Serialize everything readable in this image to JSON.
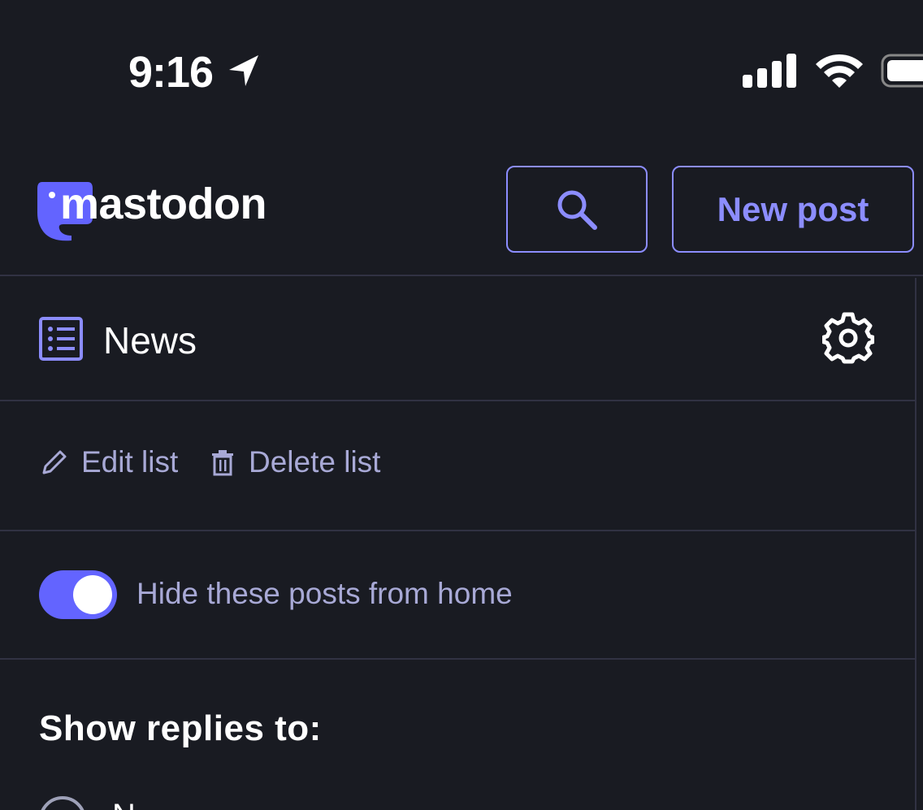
{
  "status_bar": {
    "time": "9:16",
    "icons": [
      "location-arrow-icon",
      "cellular-signal-icon",
      "wifi-icon",
      "battery-icon"
    ]
  },
  "header": {
    "logo_text": "mastodon",
    "search_icon": "search-icon",
    "new_post_label": "New post"
  },
  "list": {
    "icon": "list-icon",
    "title": "News",
    "settings_icon": "gear-icon"
  },
  "actions": {
    "edit_label": "Edit list",
    "delete_label": "Delete list"
  },
  "exclusive": {
    "enabled": true,
    "label": "Hide these posts from home"
  },
  "replies": {
    "title": "Show replies to:",
    "first_option_label": "N"
  },
  "colors": {
    "background": "#191b22",
    "accent": "#8c8dff",
    "toggle_on": "#6364ff",
    "muted_text": "#a8a9d6",
    "divider": "#313243"
  }
}
